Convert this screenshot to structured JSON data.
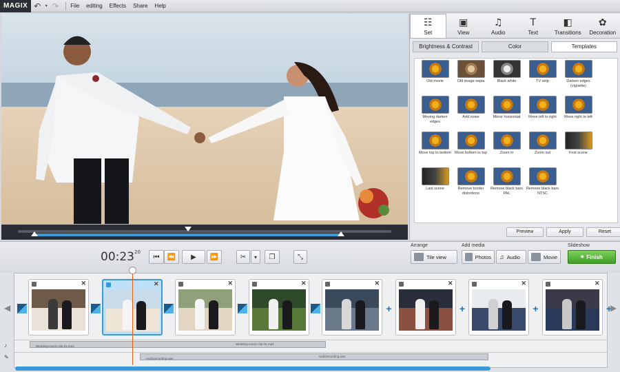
{
  "app": {
    "logo": "MAGIX"
  },
  "menu": [
    {
      "label": "File"
    },
    {
      "label": "editing"
    },
    {
      "label": "Effects"
    },
    {
      "label": "Share"
    },
    {
      "label": "Help"
    }
  ],
  "tabs": [
    {
      "label": "Set",
      "icon": "sliders-icon",
      "glyph": "☷"
    },
    {
      "label": "View",
      "icon": "camera-icon",
      "glyph": "▣"
    },
    {
      "label": "Audio",
      "icon": "music-note-icon",
      "glyph": "♫"
    },
    {
      "label": "Text",
      "icon": "text-icon",
      "glyph": "T"
    },
    {
      "label": "Transitions",
      "icon": "transitions-icon",
      "glyph": "◧"
    },
    {
      "label": "Decoration",
      "icon": "decoration-icon",
      "glyph": "✿"
    }
  ],
  "subtabs": [
    {
      "label": "Brightness & Contrast"
    },
    {
      "label": "Color"
    },
    {
      "label": "Templates"
    }
  ],
  "templates": [
    "Old movie",
    "Old image sepia",
    "Black white",
    "TV strip",
    "Darken edges (vignette)",
    "Moving darken edges",
    "Add noise",
    "Mirror horizontal",
    "Move left to right",
    "Move right to left",
    "Move top to bottom",
    "Move bottom to top",
    "Zoom in",
    "Zoom out",
    "First scene",
    "Last scene",
    "Remove border distortions",
    "Remove black bars PAL",
    "Remove black bars NTSC"
  ],
  "panel_actions": {
    "preview": "Preview",
    "apply": "Apply",
    "reset": "Reset"
  },
  "timecode": {
    "main": "00:23",
    "frames": "20"
  },
  "sections": {
    "arrange": "Arrange",
    "add_media": "Add media",
    "slideshow": "Slideshow"
  },
  "buttons": {
    "tile_view": "Tile view",
    "photos": "Photos",
    "audio": "Audio",
    "movie": "Movie",
    "finish": "Finish"
  },
  "transport": {
    "to_start": "⏮",
    "rewind": "⏪",
    "play": "▶",
    "forward": "⏩",
    "scissors": "✂",
    "dropdown": "▾",
    "popout": "⤡"
  },
  "audio_tracks": {
    "track1_left": "Wedding-music-clip-01.mp3",
    "track1_right": "Wedding-music-clip-01.mp3",
    "track2_left": "Audiorecording.wav",
    "track2_right": "Audiorecording.wav"
  },
  "colors": {
    "accent": "#3a9ad9",
    "finish": "#4caf2e",
    "playhead": "#e0601a"
  }
}
